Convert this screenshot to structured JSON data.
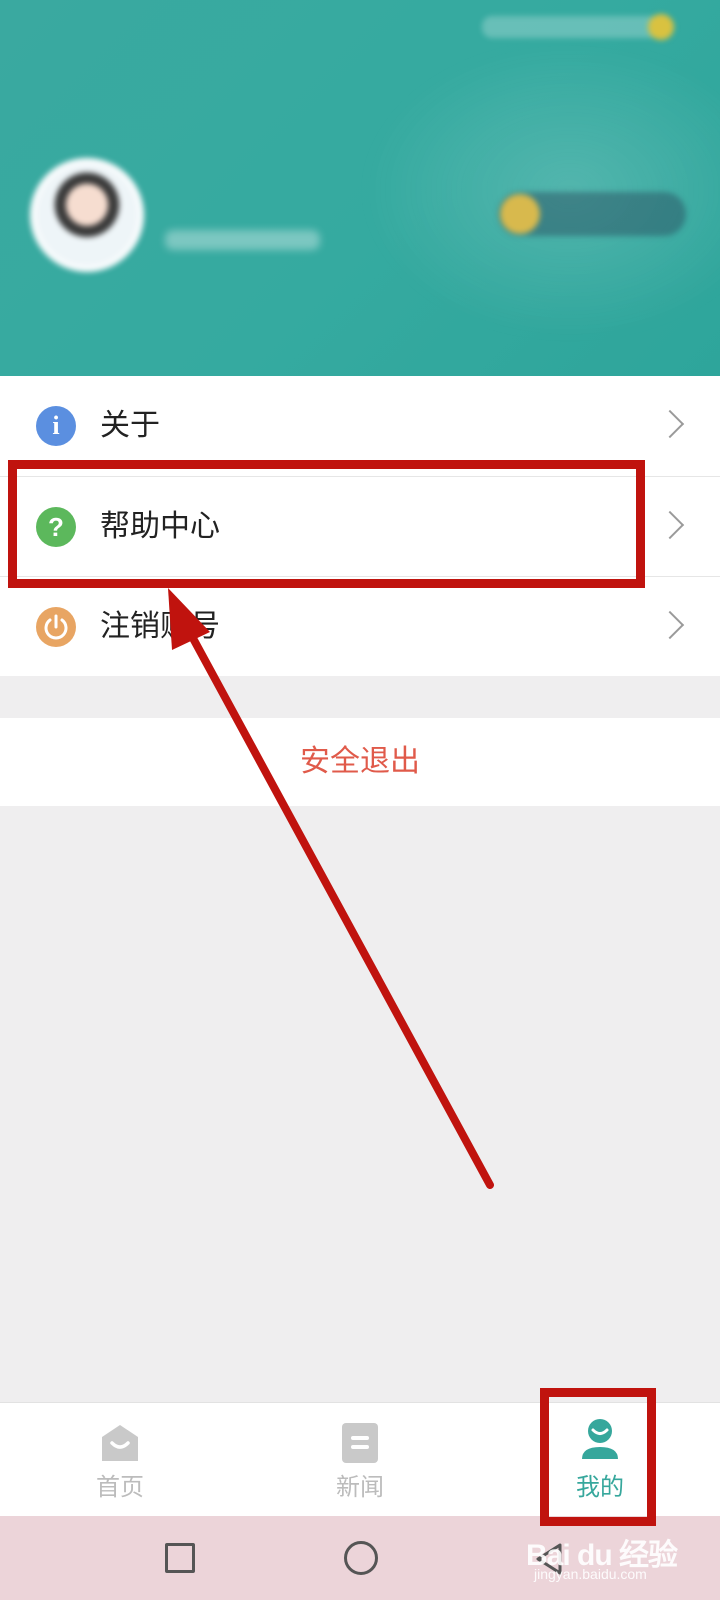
{
  "header": {
    "status_time": "",
    "user_name": "",
    "user_subtitle": "",
    "checkin_label": ""
  },
  "menu": {
    "items": [
      {
        "label": "关于",
        "icon": "info-icon"
      },
      {
        "label": "帮助中心",
        "icon": "help-icon"
      },
      {
        "label": "注销账号",
        "icon": "power-icon"
      }
    ],
    "logout_label": "安全退出"
  },
  "tabbar": {
    "tabs": [
      {
        "label": "首页",
        "icon": "home-icon",
        "active": false
      },
      {
        "label": "新闻",
        "icon": "news-icon",
        "active": false
      },
      {
        "label": "我的",
        "icon": "user-icon",
        "active": true
      }
    ]
  },
  "navbar": {
    "buttons": [
      "recents-icon",
      "home-circle-icon",
      "back-icon"
    ]
  },
  "watermark": {
    "main": "Bai du 经验",
    "url": "jingyan.baidu.com"
  },
  "colors": {
    "header_bg": "#35aaa0",
    "accent": "#36a79c",
    "logout_text": "#e05a4a",
    "annotation_red": "#c0130e",
    "navbar_bg": "#ecd4d9"
  }
}
